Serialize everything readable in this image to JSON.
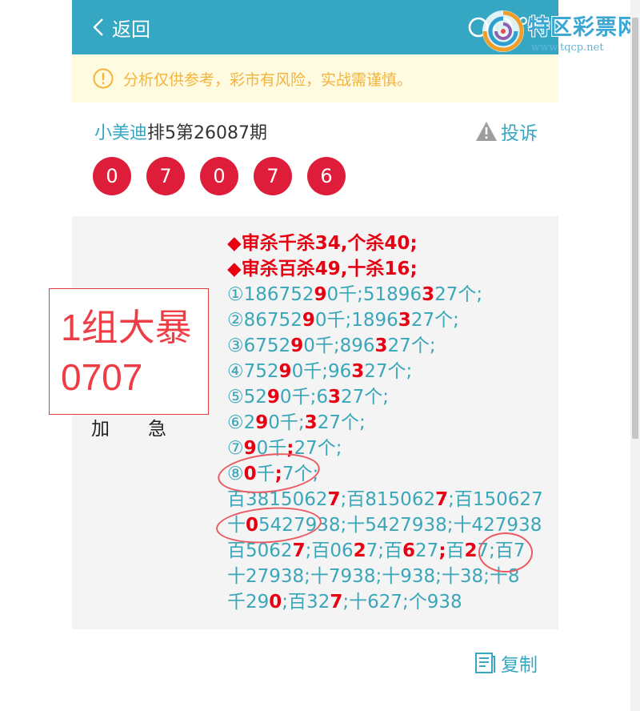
{
  "header": {
    "back_label": "返回",
    "bg_color": "#35a7c2"
  },
  "watermark": {
    "title": "特区彩票网",
    "url": "www.tqcp.net"
  },
  "notice": {
    "icon": "info-circle-icon",
    "text": "分析仅供参考，彩市有风险，实战需谨慎。"
  },
  "post": {
    "author": "小美迪",
    "period": "排5第26087期",
    "complain_label": "投诉",
    "complain_icon": "warning-triangle-icon"
  },
  "balls": [
    "0",
    "7",
    "0",
    "7",
    "6"
  ],
  "content": {
    "side_label": [
      "加",
      "急"
    ],
    "lines": [
      [
        "◆审杀千杀34,个杀40;"
      ],
      [
        "◆审杀百杀49,十杀16;"
      ],
      [
        "①18675290千;51896327个;"
      ],
      [
        "②8675290千;1896327个;"
      ],
      [
        "③675290千;896327个;"
      ],
      [
        "④75290千;96327个;"
      ],
      [
        "⑤5290千;6327个;"
      ],
      [
        "⑥290千;327个;"
      ],
      [
        "⑦90千;27个;"
      ],
      [
        "⑧0千;7个;"
      ],
      [
        "百38150627;百8150627;百150627"
      ],
      [
        "十05427938;十5427938;十427938"
      ],
      [
        "百50627;百0627;百627;百27;百7"
      ],
      [
        "十27938;十7938;十938;十38;十8"
      ],
      [
        "千290;百327;十627;个938"
      ]
    ]
  },
  "stamp": {
    "line1": "1组大暴",
    "line2": "0707"
  },
  "copy_label": "复制",
  "colors": {
    "accent": "#35a7c2",
    "ball": "#de1d3a",
    "highlight": "#e60012",
    "notice_text": "#f4b33b",
    "notice_bg": "#fffbe1"
  }
}
